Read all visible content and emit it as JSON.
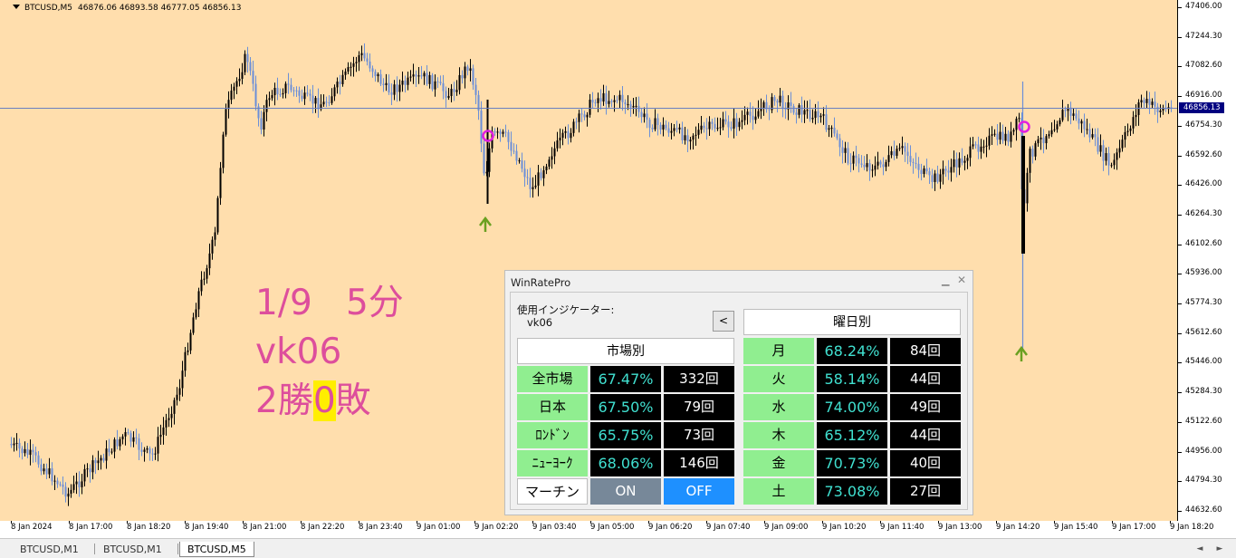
{
  "chart": {
    "symbol": "BTCUSD,M5",
    "ohlc": [
      "46876.06",
      "46893.58",
      "46777.05",
      "46856.13"
    ],
    "current_price": "46856.13",
    "colors": {
      "background": "#ffdead",
      "bull_candle": "#000000",
      "bear_candle": "#6b8fd8",
      "price_line": "#6a80c0",
      "marker_circle": "#e020e0",
      "arrow": "#6aa021"
    },
    "price_labels": [
      "47406.00",
      "47244.30",
      "47082.60",
      "46916.00",
      "46754.30",
      "46592.60",
      "46426.00",
      "46264.30",
      "46102.60",
      "45936.00",
      "45774.30",
      "45612.60",
      "45446.00",
      "45284.30",
      "45122.60",
      "44956.00",
      "44794.30",
      "44632.60"
    ],
    "time_labels": [
      "8 Jan 2024",
      "8 Jan 17:00",
      "8 Jan 18:20",
      "8 Jan 19:40",
      "8 Jan 21:00",
      "8 Jan 22:20",
      "8 Jan 23:40",
      "9 Jan 01:00",
      "9 Jan 02:20",
      "9 Jan 03:40",
      "9 Jan 05:00",
      "9 Jan 06:20",
      "9 Jan 07:40",
      "9 Jan 09:00",
      "9 Jan 10:20",
      "9 Jan 11:40",
      "9 Jan 13:00",
      "9 Jan 14:20",
      "9 Jan 15:40",
      "9 Jan 17:00",
      "9 Jan 18:20"
    ],
    "marker_circle_icons": [
      "marker-circle-icon",
      "marker-circle-icon"
    ],
    "arrow_icons": [
      "buy-arrow-icon",
      "buy-arrow-icon"
    ]
  },
  "annotation": {
    "line1": "1/9   5分",
    "line2": "vk06",
    "line3_a": "2勝",
    "line3_b": "0",
    "line3_c": "敗"
  },
  "panel": {
    "title": "WinRatePro",
    "minimize_icon": "minimize-icon",
    "close_icon": "close-icon",
    "indicator_label": "使用インジケーター:",
    "indicator_name": "vk06",
    "toggle_label": "<",
    "market_header": "市場別",
    "weekday_header": "曜日別",
    "markets": [
      {
        "label": "全市場",
        "rate": "67.47%",
        "count": "332回"
      },
      {
        "label": "日本",
        "rate": "67.50%",
        "count": "79回"
      },
      {
        "label": "ﾛﾝﾄﾞﾝ",
        "rate": "65.75%",
        "count": "73回"
      },
      {
        "label": "ﾆｭｰﾖｰｸ",
        "rate": "68.06%",
        "count": "146回"
      }
    ],
    "martingale": {
      "label": "マーチン",
      "on": "ON",
      "off": "OFF"
    },
    "weekdays": [
      {
        "label": "月",
        "rate": "68.24%",
        "count": "84回"
      },
      {
        "label": "火",
        "rate": "58.14%",
        "count": "44回"
      },
      {
        "label": "水",
        "rate": "74.00%",
        "count": "49回"
      },
      {
        "label": "木",
        "rate": "65.12%",
        "count": "44回"
      },
      {
        "label": "金",
        "rate": "70.73%",
        "count": "40回"
      },
      {
        "label": "土",
        "rate": "73.08%",
        "count": "27回"
      }
    ]
  },
  "tabs": [
    {
      "label": "BTCUSD,M1",
      "active": false
    },
    {
      "label": "BTCUSD,M1",
      "active": false
    },
    {
      "label": "BTCUSD,M5",
      "active": true
    }
  ],
  "tab_scroll": {
    "left": "◄",
    "right": "►"
  }
}
